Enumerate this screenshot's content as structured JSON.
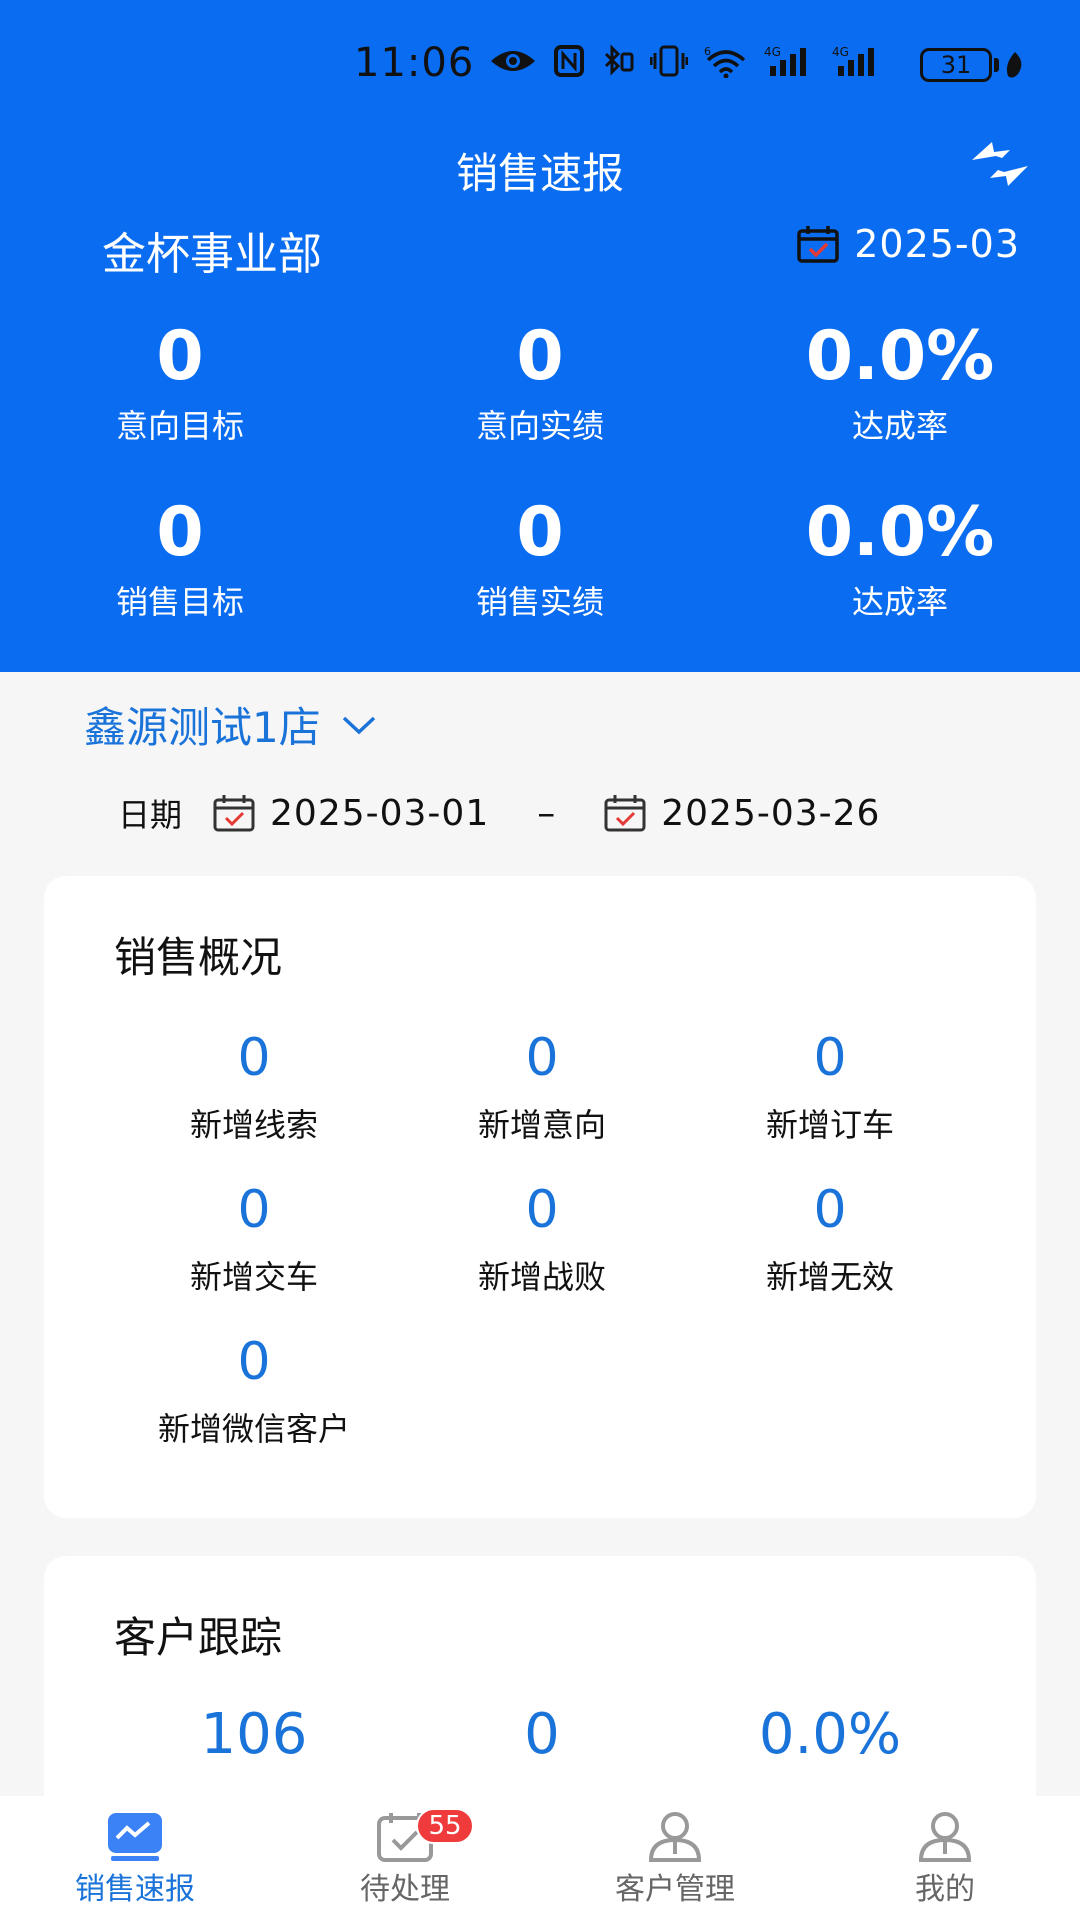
{
  "status_bar": {
    "time": "11:06",
    "battery": "31"
  },
  "header": {
    "title": "销售速报",
    "org": "金杯事业部",
    "month": "2025-03",
    "kpis": [
      [
        {
          "value": "0",
          "label": "意向目标"
        },
        {
          "value": "0",
          "label": "意向实绩"
        },
        {
          "value": "0.0%",
          "label": "达成率"
        }
      ],
      [
        {
          "value": "0",
          "label": "销售目标"
        },
        {
          "value": "0",
          "label": "销售实绩"
        },
        {
          "value": "0.0%",
          "label": "达成率"
        }
      ]
    ]
  },
  "filters": {
    "store": "鑫源测试1店",
    "date_label": "日期",
    "start_date": "2025-03-01",
    "separator": "–",
    "end_date": "2025-03-26"
  },
  "overview": {
    "title": "销售概况",
    "items": [
      {
        "value": "0",
        "label": "新增线索"
      },
      {
        "value": "0",
        "label": "新增意向"
      },
      {
        "value": "0",
        "label": "新增订车"
      },
      {
        "value": "0",
        "label": "新增交车"
      },
      {
        "value": "0",
        "label": "新增战败"
      },
      {
        "value": "0",
        "label": "新增无效"
      },
      {
        "value": "0",
        "label": "新增微信客户"
      }
    ]
  },
  "tracking": {
    "title": "客户跟踪",
    "values": [
      "106",
      "0",
      "0.0%"
    ]
  },
  "tabbar": {
    "tabs": [
      {
        "label": "销售速报",
        "icon": "chart-icon",
        "active": true
      },
      {
        "label": "待处理",
        "icon": "calendar-check-icon",
        "badge": "55"
      },
      {
        "label": "客户管理",
        "icon": "person-icon"
      },
      {
        "label": "我的",
        "icon": "person-icon"
      }
    ]
  },
  "colors": {
    "primary": "#0a6cf0",
    "accent_text": "#1a73d9",
    "badge": "#ef3b3b"
  }
}
